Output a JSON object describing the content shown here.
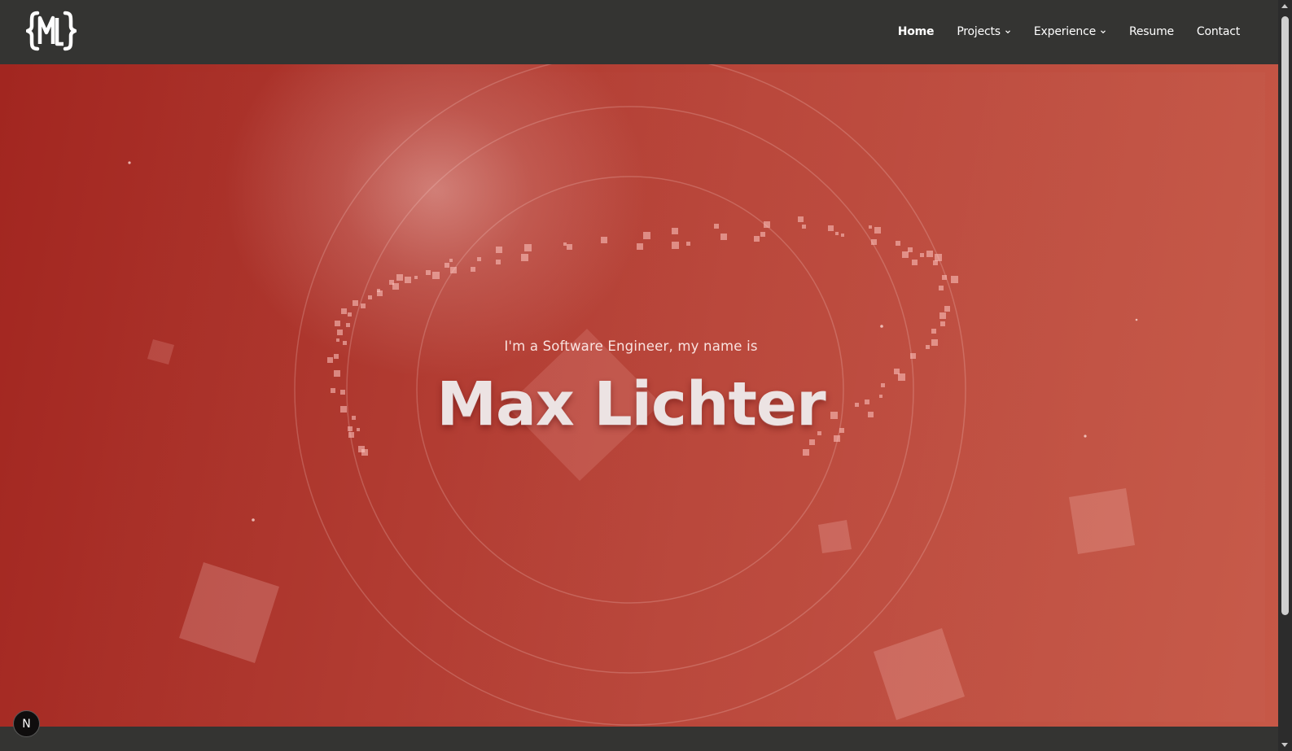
{
  "nav": {
    "logo_text": "{ML}",
    "items": [
      {
        "label": "Home",
        "active": true,
        "dropdown": false
      },
      {
        "label": "Projects",
        "active": false,
        "dropdown": true
      },
      {
        "label": "Experience",
        "active": false,
        "dropdown": true
      },
      {
        "label": "Resume",
        "active": false,
        "dropdown": false
      },
      {
        "label": "Contact",
        "active": false,
        "dropdown": false
      }
    ]
  },
  "hero": {
    "subtitle": "I'm a Software Engineer, my name is",
    "name": "Max Lichter"
  },
  "badge": {
    "label": "N"
  },
  "colors": {
    "navbar_bg": "#343432",
    "hero_start": "#a22620",
    "hero_end": "#c65847",
    "text": "#ffffff"
  }
}
